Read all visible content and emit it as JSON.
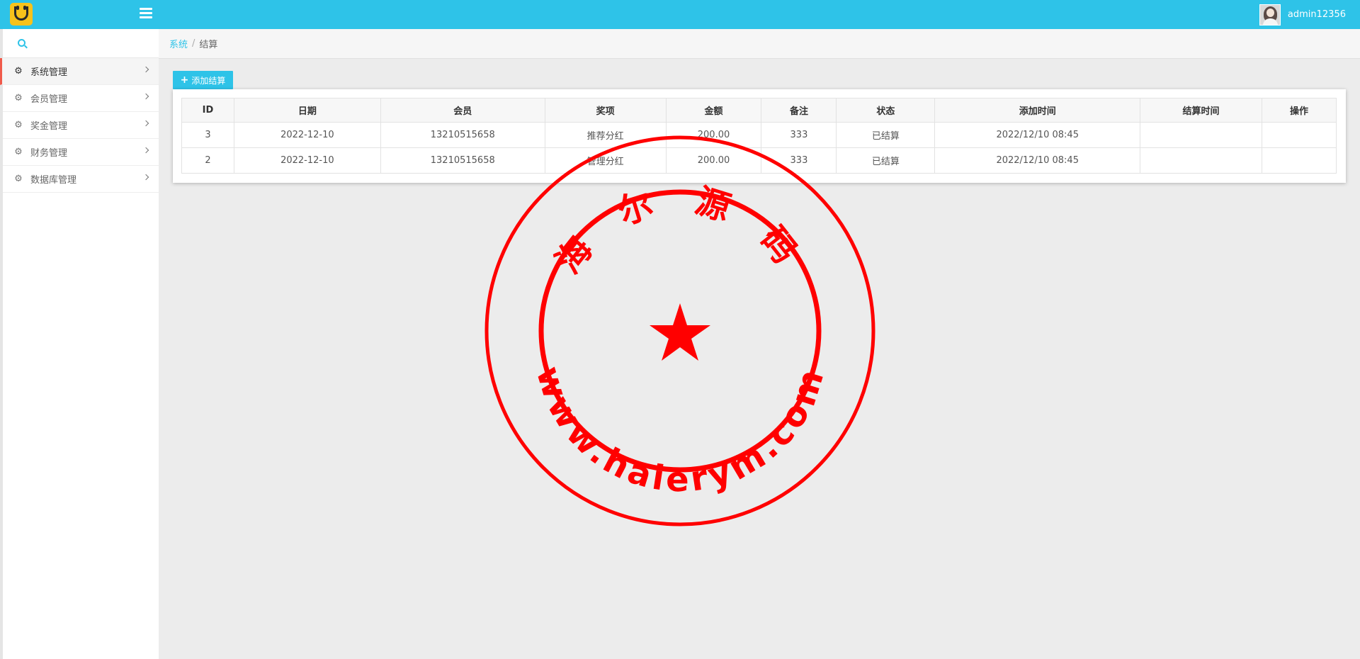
{
  "header": {
    "username": "admin12356",
    "brand_color": "#2ec3e8"
  },
  "sidebar": {
    "items": [
      {
        "label": "系统管理",
        "icon": "gear-icon",
        "active": true
      },
      {
        "label": "会员管理",
        "icon": "gear-icon",
        "active": false
      },
      {
        "label": "奖金管理",
        "icon": "gear-icon",
        "active": false
      },
      {
        "label": "财务管理",
        "icon": "gear-icon",
        "active": false
      },
      {
        "label": "数据库管理",
        "icon": "gear-icon",
        "active": false
      }
    ]
  },
  "breadcrumb": {
    "parent": "系统",
    "separator": "/",
    "current": "结算"
  },
  "toolbar": {
    "add_label": "添加结算"
  },
  "table": {
    "columns": [
      "ID",
      "日期",
      "会员",
      "奖项",
      "金额",
      "备注",
      "状态",
      "添加时间",
      "结算时间",
      "操作"
    ],
    "rows": [
      [
        "3",
        "2022-12-10",
        "13210515658",
        "推荐分红",
        "200.00",
        "333",
        "已结算",
        "2022/12/10 08:45",
        "",
        ""
      ],
      [
        "2",
        "2022-12-10",
        "13210515658",
        "管理分红",
        "200.00",
        "333",
        "已结算",
        "2022/12/10 08:45",
        "",
        ""
      ]
    ]
  },
  "watermark": {
    "top_text": "海 尔 源 码",
    "bottom_text": "www.haierym.com",
    "color": "#ff0000"
  }
}
